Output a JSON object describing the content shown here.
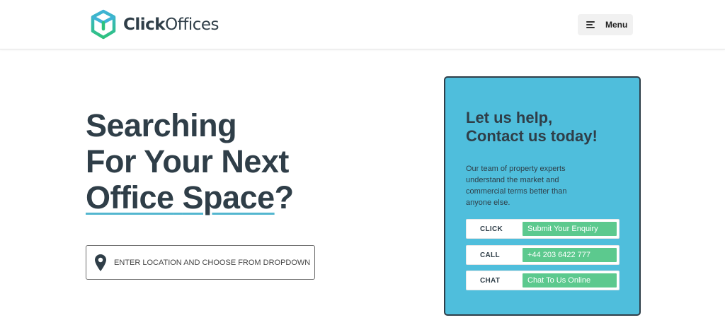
{
  "header": {
    "logo": {
      "bold": "Click",
      "light": "Offices"
    },
    "menu_label": "Menu"
  },
  "hero": {
    "title_line1": "Searching",
    "title_line2": "For Your Next",
    "title_line3_word1": "Office",
    "title_line3_space": " ",
    "title_line3_word2": "Space",
    "title_line3_punct": "?",
    "search_placeholder": "ENTER LOCATION AND CHOOSE FROM DROPDOWN"
  },
  "contact_card": {
    "title_line1": "Let us help,",
    "title_line2": "Contact us today!",
    "description": "Our team of property experts understand the market and commercial terms better than anyone else.",
    "rows": [
      {
        "key": "CLICK",
        "value": "Submit Your Enquiry"
      },
      {
        "key": "CALL",
        "value": "+44 203 6422 777"
      },
      {
        "key": "CHAT",
        "value": "Chat To Us Online"
      }
    ]
  },
  "colors": {
    "brand_dark": "#2f3e48",
    "card_blue": "#4fbedc",
    "action_green": "#5cc98e",
    "underline_blue": "#53b6cf",
    "logo_green": "#2ec27e",
    "logo_teal": "#3fb3d6"
  },
  "icons": {
    "logo": "cube-logo-icon",
    "menu": "hamburger-icon",
    "search": "location-pin-icon"
  }
}
